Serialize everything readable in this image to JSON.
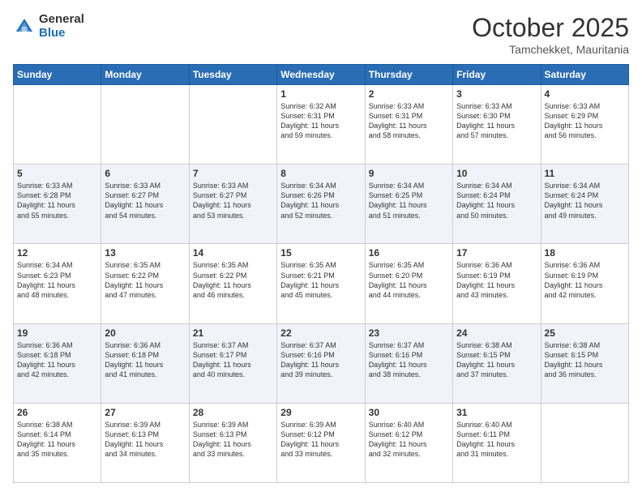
{
  "header": {
    "logo_general": "General",
    "logo_blue": "Blue",
    "month": "October 2025",
    "location": "Tamchekket, Mauritania"
  },
  "days_of_week": [
    "Sunday",
    "Monday",
    "Tuesday",
    "Wednesday",
    "Thursday",
    "Friday",
    "Saturday"
  ],
  "weeks": [
    [
      {
        "day": "",
        "info": ""
      },
      {
        "day": "",
        "info": ""
      },
      {
        "day": "",
        "info": ""
      },
      {
        "day": "1",
        "info": "Sunrise: 6:32 AM\nSunset: 6:31 PM\nDaylight: 11 hours\nand 59 minutes."
      },
      {
        "day": "2",
        "info": "Sunrise: 6:33 AM\nSunset: 6:31 PM\nDaylight: 11 hours\nand 58 minutes."
      },
      {
        "day": "3",
        "info": "Sunrise: 6:33 AM\nSunset: 6:30 PM\nDaylight: 11 hours\nand 57 minutes."
      },
      {
        "day": "4",
        "info": "Sunrise: 6:33 AM\nSunset: 6:29 PM\nDaylight: 11 hours\nand 56 minutes."
      }
    ],
    [
      {
        "day": "5",
        "info": "Sunrise: 6:33 AM\nSunset: 6:28 PM\nDaylight: 11 hours\nand 55 minutes."
      },
      {
        "day": "6",
        "info": "Sunrise: 6:33 AM\nSunset: 6:27 PM\nDaylight: 11 hours\nand 54 minutes."
      },
      {
        "day": "7",
        "info": "Sunrise: 6:33 AM\nSunset: 6:27 PM\nDaylight: 11 hours\nand 53 minutes."
      },
      {
        "day": "8",
        "info": "Sunrise: 6:34 AM\nSunset: 6:26 PM\nDaylight: 11 hours\nand 52 minutes."
      },
      {
        "day": "9",
        "info": "Sunrise: 6:34 AM\nSunset: 6:25 PM\nDaylight: 11 hours\nand 51 minutes."
      },
      {
        "day": "10",
        "info": "Sunrise: 6:34 AM\nSunset: 6:24 PM\nDaylight: 11 hours\nand 50 minutes."
      },
      {
        "day": "11",
        "info": "Sunrise: 6:34 AM\nSunset: 6:24 PM\nDaylight: 11 hours\nand 49 minutes."
      }
    ],
    [
      {
        "day": "12",
        "info": "Sunrise: 6:34 AM\nSunset: 6:23 PM\nDaylight: 11 hours\nand 48 minutes."
      },
      {
        "day": "13",
        "info": "Sunrise: 6:35 AM\nSunset: 6:22 PM\nDaylight: 11 hours\nand 47 minutes."
      },
      {
        "day": "14",
        "info": "Sunrise: 6:35 AM\nSunset: 6:22 PM\nDaylight: 11 hours\nand 46 minutes."
      },
      {
        "day": "15",
        "info": "Sunrise: 6:35 AM\nSunset: 6:21 PM\nDaylight: 11 hours\nand 45 minutes."
      },
      {
        "day": "16",
        "info": "Sunrise: 6:35 AM\nSunset: 6:20 PM\nDaylight: 11 hours\nand 44 minutes."
      },
      {
        "day": "17",
        "info": "Sunrise: 6:36 AM\nSunset: 6:19 PM\nDaylight: 11 hours\nand 43 minutes."
      },
      {
        "day": "18",
        "info": "Sunrise: 6:36 AM\nSunset: 6:19 PM\nDaylight: 11 hours\nand 42 minutes."
      }
    ],
    [
      {
        "day": "19",
        "info": "Sunrise: 6:36 AM\nSunset: 6:18 PM\nDaylight: 11 hours\nand 42 minutes."
      },
      {
        "day": "20",
        "info": "Sunrise: 6:36 AM\nSunset: 6:18 PM\nDaylight: 11 hours\nand 41 minutes."
      },
      {
        "day": "21",
        "info": "Sunrise: 6:37 AM\nSunset: 6:17 PM\nDaylight: 11 hours\nand 40 minutes."
      },
      {
        "day": "22",
        "info": "Sunrise: 6:37 AM\nSunset: 6:16 PM\nDaylight: 11 hours\nand 39 minutes."
      },
      {
        "day": "23",
        "info": "Sunrise: 6:37 AM\nSunset: 6:16 PM\nDaylight: 11 hours\nand 38 minutes."
      },
      {
        "day": "24",
        "info": "Sunrise: 6:38 AM\nSunset: 6:15 PM\nDaylight: 11 hours\nand 37 minutes."
      },
      {
        "day": "25",
        "info": "Sunrise: 6:38 AM\nSunset: 6:15 PM\nDaylight: 11 hours\nand 36 minutes."
      }
    ],
    [
      {
        "day": "26",
        "info": "Sunrise: 6:38 AM\nSunset: 6:14 PM\nDaylight: 11 hours\nand 35 minutes."
      },
      {
        "day": "27",
        "info": "Sunrise: 6:39 AM\nSunset: 6:13 PM\nDaylight: 11 hours\nand 34 minutes."
      },
      {
        "day": "28",
        "info": "Sunrise: 6:39 AM\nSunset: 6:13 PM\nDaylight: 11 hours\nand 33 minutes."
      },
      {
        "day": "29",
        "info": "Sunrise: 6:39 AM\nSunset: 6:12 PM\nDaylight: 11 hours\nand 33 minutes."
      },
      {
        "day": "30",
        "info": "Sunrise: 6:40 AM\nSunset: 6:12 PM\nDaylight: 11 hours\nand 32 minutes."
      },
      {
        "day": "31",
        "info": "Sunrise: 6:40 AM\nSunset: 6:11 PM\nDaylight: 11 hours\nand 31 minutes."
      },
      {
        "day": "",
        "info": ""
      }
    ]
  ]
}
